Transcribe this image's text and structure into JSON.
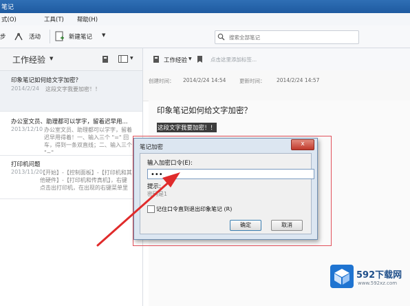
{
  "window": {
    "title_fragment": "笔记"
  },
  "menu": [
    {
      "label": "式(O)"
    },
    {
      "label": "工具(T)"
    },
    {
      "label": "帮助(H)"
    }
  ],
  "toolbar": {
    "sync_label": "步",
    "activity_label": "活动",
    "new_note_label": "新建笔记",
    "search_placeholder": "搜索全部笔记"
  },
  "list": {
    "notebook_name": "工作经验",
    "notes": [
      {
        "title": "印象笔记如何给文字加密？",
        "date": "2014/2/24",
        "snippet": "这段文字我要加密！！"
      },
      {
        "title": "办公室文员、助理都可以学字，留着迟早用...",
        "date": "2013/12/10",
        "snippet": "办公室文员、助理都可以学字，留着迟早用得着！一、输入三个 \"=\" 回车，得到一条双直线；二、输入三个 \"~\""
      },
      {
        "title": "打印机问题",
        "date": "2013/11/20",
        "snippet": "【开始】-【控制面板】-【打印机和其他硬件】-【打印机和传真机】，右键点击出打印机，在出现的右键菜单里面选择【..."
      }
    ]
  },
  "note": {
    "notebook": "工作经验",
    "tags_placeholder": "点击这里添加标签...",
    "created_label": "创建时间：",
    "created_value": "2014/2/24 14:54",
    "updated_label": "更新时间：",
    "updated_value": "2014/2/24 14:57",
    "title": "印象笔记如何给文字加密？",
    "selected_text": "这段文字我要加密！！"
  },
  "dialog": {
    "title": "笔记加密",
    "close_label": "x",
    "password_label": "输入加密口令(E):",
    "password_value": "•••",
    "hint_label": "提示:",
    "hint_value": "密码是1",
    "remember_label": "记住口令直到退出印象笔记 (R)",
    "ok_label": "确定",
    "cancel_label": "取消"
  },
  "watermark": {
    "brand": "592下载网",
    "url": "www.592xz.com"
  },
  "colors": {
    "titlebar": "#2f6fb5",
    "arrow": "#e02b2b",
    "selection": "#3c3c3c",
    "redbox": "#e0505a",
    "logo": "#1f74d1"
  }
}
